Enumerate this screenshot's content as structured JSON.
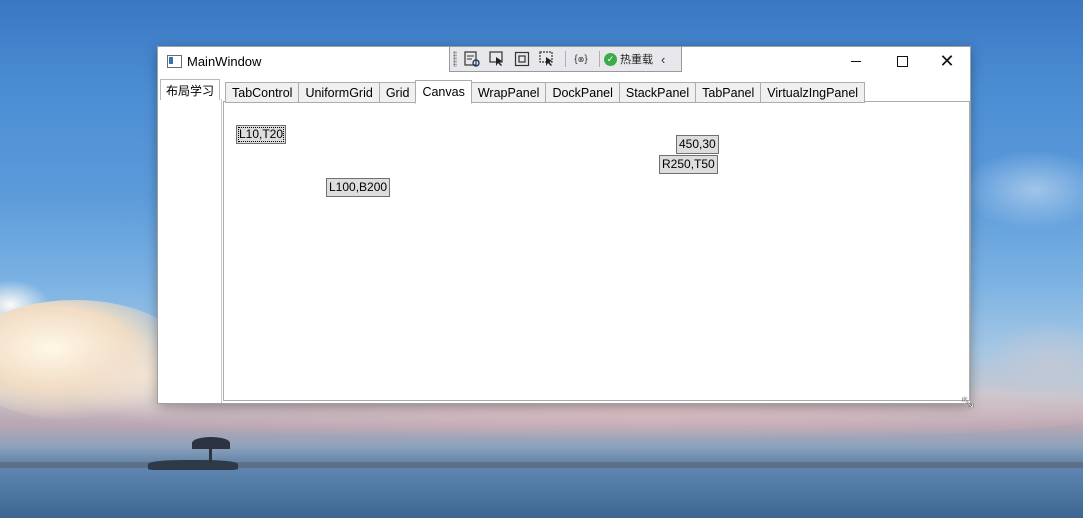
{
  "window": {
    "title": "MainWindow",
    "minimize_glyph": "",
    "close_glyph": "✕"
  },
  "debug_toolbar": {
    "hot_reload_label": "热重载",
    "collapse_glyph": "‹",
    "icons": [
      "visual-tree-icon",
      "select-element-icon",
      "display-adorners-icon",
      "track-focus-icon",
      "binding-failures-icon",
      "hot-reload-check-icon"
    ]
  },
  "outer_tab": {
    "label": "布局学习"
  },
  "tabs": [
    {
      "label": "TabControl",
      "selected": false
    },
    {
      "label": "UniformGrid",
      "selected": false
    },
    {
      "label": "Grid",
      "selected": false
    },
    {
      "label": "Canvas",
      "selected": true
    },
    {
      "label": "WrapPanel",
      "selected": false
    },
    {
      "label": "DockPanel",
      "selected": false
    },
    {
      "label": "StackPanel",
      "selected": false
    },
    {
      "label": "TabPanel",
      "selected": false
    },
    {
      "label": "VirtualzIngPanel",
      "selected": false
    }
  ],
  "canvas_buttons": {
    "b1": "L10,T20",
    "b2": "450,30",
    "b3": "R250,T50",
    "b4": "L100,B200"
  },
  "colors": {
    "accent_check": "#3cab4a",
    "button_face": "#dddddd"
  }
}
